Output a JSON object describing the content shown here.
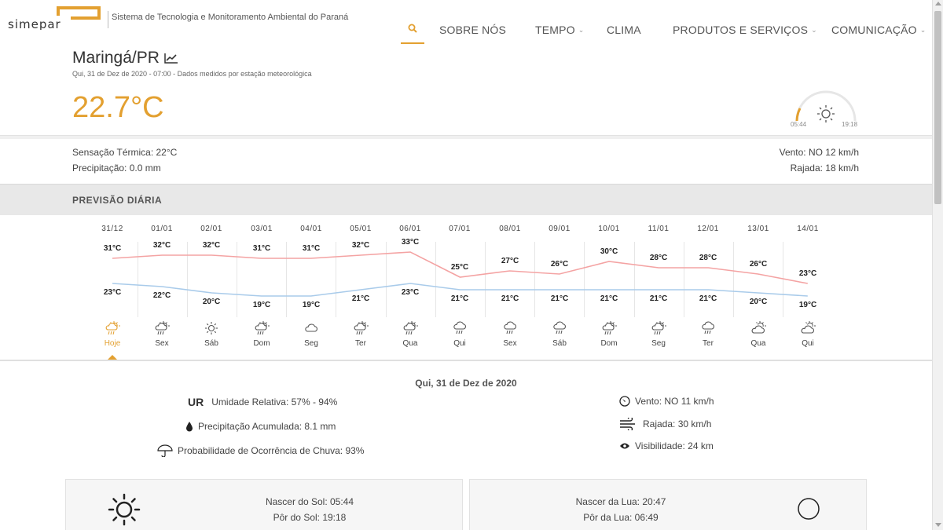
{
  "header": {
    "logo_text": "simepar",
    "tagline": "Sistema de Tecnologia e Monitoramento Ambiental do Paraná",
    "nav": [
      {
        "label": "SOBRE NÓS",
        "dropdown": false
      },
      {
        "label": "TEMPO",
        "dropdown": true
      },
      {
        "label": "CLIMA",
        "dropdown": false
      },
      {
        "label": "PRODUTOS E SERVIÇOS",
        "dropdown": true
      },
      {
        "label": "COMUNICAÇÃO",
        "dropdown": true
      }
    ],
    "accent_color": "#e3a030"
  },
  "current": {
    "city": "Maringá/PR",
    "subtitle": "Qui, 31 de Dez de 2020 - 07:00 - Dados medidos por estação meteorológica",
    "temperature": "22.7°C",
    "sunrise": "05:44",
    "sunset": "19:18",
    "feels_like": "Sensação Térmica: 22°C",
    "precipitation": "Precipitação: 0.0 mm",
    "wind": "Vento: NO 12 km/h",
    "gust": "Rajada: 18 km/h"
  },
  "daily": {
    "title": "PREVISÃO DIÁRIA",
    "days": [
      {
        "date": "31/12",
        "max": "31°C",
        "min": "23°C",
        "day": "Hoje",
        "icon": "sun-rain"
      },
      {
        "date": "01/01",
        "max": "32°C",
        "min": "22°C",
        "day": "Sex",
        "icon": "sun-rain"
      },
      {
        "date": "02/01",
        "max": "32°C",
        "min": "20°C",
        "day": "Sáb",
        "icon": "sun"
      },
      {
        "date": "03/01",
        "max": "31°C",
        "min": "19°C",
        "day": "Dom",
        "icon": "sun-rain"
      },
      {
        "date": "04/01",
        "max": "31°C",
        "min": "19°C",
        "day": "Seg",
        "icon": "cloud"
      },
      {
        "date": "05/01",
        "max": "32°C",
        "min": "21°C",
        "day": "Ter",
        "icon": "sun-rain"
      },
      {
        "date": "06/01",
        "max": "33°C",
        "min": "23°C",
        "day": "Qua",
        "icon": "sun-rain"
      },
      {
        "date": "07/01",
        "max": "25°C",
        "min": "21°C",
        "day": "Qui",
        "icon": "rain"
      },
      {
        "date": "08/01",
        "max": "27°C",
        "min": "21°C",
        "day": "Sex",
        "icon": "rain"
      },
      {
        "date": "09/01",
        "max": "26°C",
        "min": "21°C",
        "day": "Sáb",
        "icon": "rain"
      },
      {
        "date": "10/01",
        "max": "30°C",
        "min": "21°C",
        "day": "Dom",
        "icon": "sun-rain"
      },
      {
        "date": "11/01",
        "max": "28°C",
        "min": "21°C",
        "day": "Seg",
        "icon": "sun-rain"
      },
      {
        "date": "12/01",
        "max": "28°C",
        "min": "21°C",
        "day": "Ter",
        "icon": "rain"
      },
      {
        "date": "13/01",
        "max": "26°C",
        "min": "20°C",
        "day": "Qua",
        "icon": "sun-cloud"
      },
      {
        "date": "14/01",
        "max": "23°C",
        "min": "19°C",
        "day": "Qui",
        "icon": "sun-cloud"
      }
    ],
    "max_values": [
      31,
      32,
      32,
      31,
      31,
      32,
      33,
      25,
      27,
      26,
      30,
      28,
      28,
      26,
      23
    ],
    "min_values": [
      23,
      22,
      20,
      19,
      19,
      21,
      23,
      21,
      21,
      21,
      21,
      21,
      21,
      20,
      19
    ],
    "max_color": "#f4a3a3",
    "min_color": "#a9cbea"
  },
  "details": {
    "date": "Qui, 31 de Dez de 2020",
    "ur_label": "UR",
    "humidity": "Umidade Relativa: 57% - 94%",
    "precip_acc": "Precipitação Acumulada: 8.1 mm",
    "rain_prob": "Probabilidade de Ocorrência de Chuva: 93%",
    "wind": "Vento: NO 11 km/h",
    "gust": "Rajada: 30 km/h",
    "visibility": "Visibilidade: 24 km"
  },
  "sun_card": {
    "sunrise": "Nascer do Sol: 05:44",
    "sunset": "Pôr do Sol: 19:18"
  },
  "moon_card": {
    "moonrise": "Nascer da Lua: 20:47",
    "moonset": "Pôr da Lua: 06:49"
  }
}
